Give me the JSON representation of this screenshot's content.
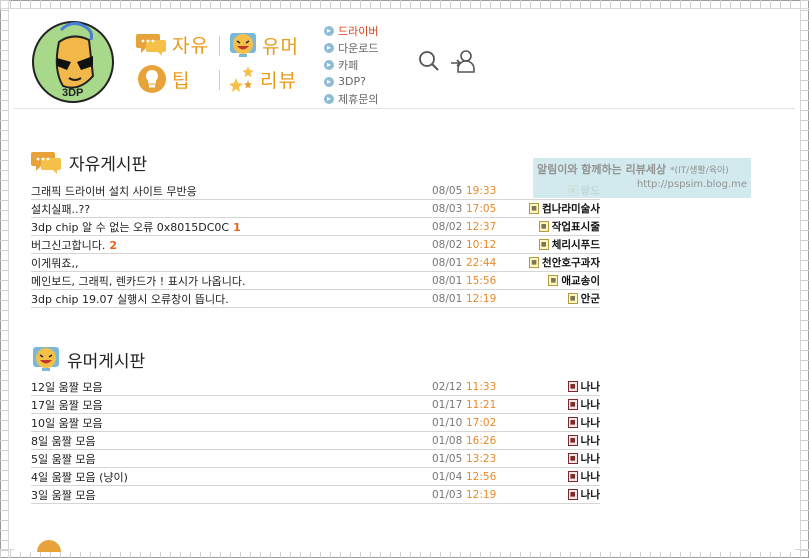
{
  "header": {
    "logo_text": "3DP",
    "nav_big": [
      {
        "label": "자유",
        "icon": "speech-bubbles-icon"
      },
      {
        "label": "유머",
        "icon": "laughing-face-icon"
      },
      {
        "label": "팁",
        "icon": "lightbulb-icon"
      },
      {
        "label": "리뷰",
        "icon": "sparkle-stars-icon"
      }
    ],
    "nav_small": [
      {
        "label": "드라이버",
        "active": true
      },
      {
        "label": "다운로드",
        "active": false
      },
      {
        "label": "카페",
        "active": false
      },
      {
        "label": "3DP?",
        "active": false
      },
      {
        "label": "제휴문의",
        "active": false
      }
    ],
    "search_icon": "search-icon",
    "login_icon": "user-login-icon"
  },
  "ad": {
    "line1": "알림이와 함께하는 리뷰세상",
    "line1_suffix": "*(IT/생활/육아)",
    "line2": "http://pspsim.blog.me"
  },
  "free_board": {
    "title": "자유게시판",
    "posts": [
      {
        "title": "그래픽 드라이버 설치 사이트 무반응",
        "comments": "",
        "date": "08/05",
        "time": "19:33",
        "author": "왕도",
        "level": "gold"
      },
      {
        "title": "설치실패..??",
        "comments": "",
        "date": "08/03",
        "time": "17:05",
        "author": "컴나라미술사",
        "level": "gold"
      },
      {
        "title": "3dp chip 알 수 없는 오류 0x8015DC0C",
        "comments": "1",
        "date": "08/02",
        "time": "12:37",
        "author": "작업표시줄",
        "level": "gold"
      },
      {
        "title": "버그신고합니다.",
        "comments": "2",
        "date": "08/02",
        "time": "10:12",
        "author": "체리시푸드",
        "level": "gold"
      },
      {
        "title": "이게뭐죠,,",
        "comments": "",
        "date": "08/01",
        "time": "22:44",
        "author": "천안호구과자",
        "level": "gold"
      },
      {
        "title": "메인보드, 그래픽, 렌카드가 ! 표시가 나옵니다.",
        "comments": "",
        "date": "08/01",
        "time": "15:56",
        "author": "애교송이",
        "level": "gold"
      },
      {
        "title": "3dp chip 19.07 실행시 오류창이 뜹니다.",
        "comments": "",
        "date": "08/01",
        "time": "12:19",
        "author": "안군",
        "level": "gold"
      }
    ]
  },
  "humor_board": {
    "title": "유머게시판",
    "posts": [
      {
        "title": "12일 움짤 모음",
        "comments": "",
        "date": "02/12",
        "time": "11:33",
        "author": "나나",
        "level": "maroon"
      },
      {
        "title": "17일 움짤 모음",
        "comments": "",
        "date": "01/17",
        "time": "11:21",
        "author": "나나",
        "level": "maroon"
      },
      {
        "title": "10일 움짤 모음",
        "comments": "",
        "date": "01/10",
        "time": "17:02",
        "author": "나나",
        "level": "maroon"
      },
      {
        "title": "8일 움짤 모음",
        "comments": "",
        "date": "01/08",
        "time": "16:26",
        "author": "나나",
        "level": "maroon"
      },
      {
        "title": "5일 움짤 모음",
        "comments": "",
        "date": "01/05",
        "time": "13:23",
        "author": "나나",
        "level": "maroon"
      },
      {
        "title": "4일 움짤 모음 (냥이)",
        "comments": "",
        "date": "01/04",
        "time": "12:56",
        "author": "나나",
        "level": "maroon"
      },
      {
        "title": "3일 움짤 모음",
        "comments": "",
        "date": "01/03",
        "time": "12:19",
        "author": "나나",
        "level": "maroon"
      }
    ]
  },
  "colors": {
    "accent_orange": "#e89a19",
    "active_nav": "#d9421a",
    "time_orange": "#e88a2a",
    "ad_bg": "#cfe8ec"
  }
}
